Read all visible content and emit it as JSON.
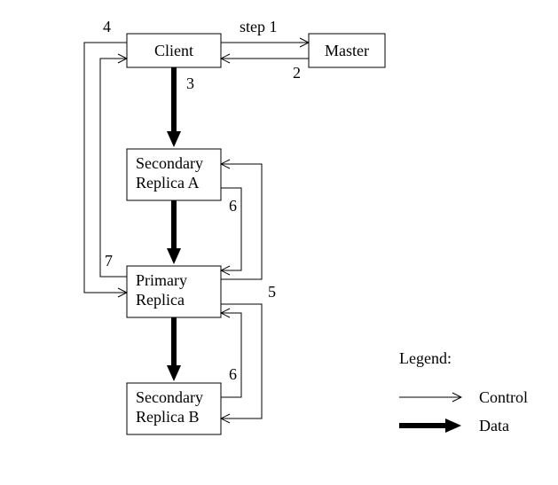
{
  "nodes": {
    "client": "Client",
    "master": "Master",
    "secondaryA": "Secondary\nReplica A",
    "primary": "Primary\nReplica",
    "secondaryB": "Secondary\nReplica B"
  },
  "edgeLabels": {
    "step1": "step 1",
    "e2": "2",
    "e3": "3",
    "e4": "4",
    "e5": "5",
    "e6a": "6",
    "e6b": "6",
    "e7": "7"
  },
  "legend": {
    "title": "Legend:",
    "control": "Control",
    "data": "Data"
  }
}
